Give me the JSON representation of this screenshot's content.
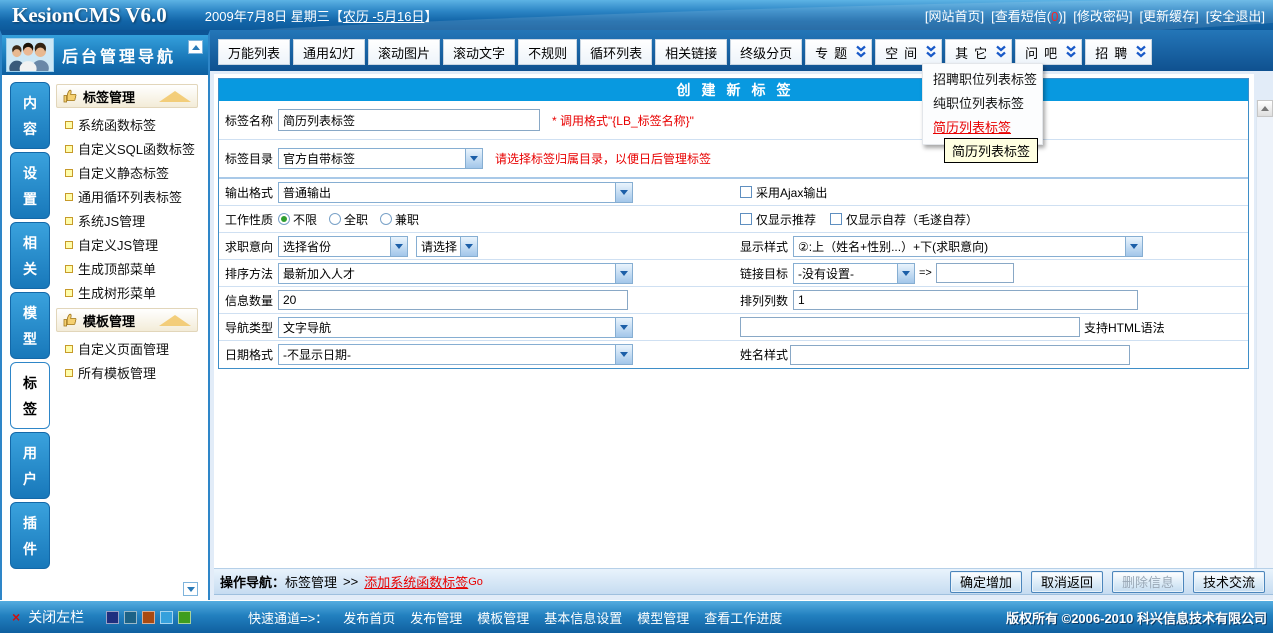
{
  "app": {
    "title": "KesionCMS V6.0"
  },
  "header": {
    "date": "2009年7月8日 星期三",
    "lunar_open": "【",
    "lunar": "农历 -5月16日",
    "lunar_close": "】",
    "link_home": "[网站首页]",
    "sms_pre": "[查看短信(",
    "sms_count": "0",
    "sms_post": ")]",
    "link_password": "[修改密码]",
    "link_cache": "[更新缓存]",
    "link_logout": "[安全退出]"
  },
  "sidebar": {
    "title": "后台管理导航",
    "tabs": [
      {
        "label": "内容"
      },
      {
        "label": "设置"
      },
      {
        "label": "相关"
      },
      {
        "label": "模型"
      },
      {
        "label": "标签"
      },
      {
        "label": "用户"
      },
      {
        "label": "插件"
      }
    ],
    "section1": {
      "title": "标签管理",
      "items": [
        "系统函数标签",
        "自定义SQL函数标签",
        "自定义静态标签",
        "通用循环列表标签",
        "系统JS管理",
        "自定义JS管理",
        "生成顶部菜单",
        "生成树形菜单"
      ]
    },
    "section2": {
      "title": "模板管理",
      "items": [
        "自定义页面管理",
        "所有模板管理"
      ]
    },
    "close_icon": "×",
    "close_label": "关闭左栏"
  },
  "nav": {
    "tabs": [
      "万能列表",
      "通用幻灯",
      "滚动图片",
      "滚动文字",
      "不规则",
      "循环列表",
      "相关链接",
      "终级分页"
    ],
    "dd_tabs": [
      "专题",
      "空间",
      "其它",
      "问吧",
      "招聘"
    ]
  },
  "menu": {
    "items": [
      "招聘职位列表标签",
      "纯职位列表标签",
      "简历列表标签"
    ],
    "tooltip": "简历列表标签"
  },
  "form": {
    "title": "创建新标签",
    "tag_name_label": "标签名称",
    "tag_name_value": "简历列表标签",
    "tag_name_hint": "* 调用格式\"{LB_标签名称}\"",
    "tag_dir_label": "标签目录",
    "tag_dir_value": "官方自带标签",
    "tag_dir_hint": "请选择标签归属目录，以便日后管理标签",
    "output_label": "输出格式",
    "output_value": "普通输出",
    "ajax_label": "采用Ajax输出",
    "work_label": "工作性质",
    "work_opt1": "不限",
    "work_opt2": "全职",
    "work_opt3": "兼职",
    "rec_label": "仅显示推荐",
    "self_label": "仅显示自荐（毛遂自荐）",
    "intent_label": "求职意向",
    "province_value": "选择省份",
    "city_value": "请选择",
    "style_label": "显示样式",
    "style_value": "②:上（姓名+性别...）+下(求职意向)",
    "sort_label": "排序方法",
    "sort_value": "最新加入人才",
    "target_label": "链接目标",
    "target_value": "-没有设置-",
    "target_arrow": "=>",
    "count_label": "信息数量",
    "count_value": "20",
    "cols_label": "排列列数",
    "cols_value": "1",
    "navtype_label": "导航类型",
    "navtype_value": "文字导航",
    "html_hint": "支持HTML语法",
    "date_label": "日期格式",
    "date_value": "-不显示日期-",
    "name_label": "姓名样式"
  },
  "action": {
    "nav_label": "操作导航：",
    "nav_path": "标签管理",
    "nav_sep": ">>",
    "nav_link": "添加系统函数标签",
    "nav_go": "Go",
    "btn_confirm": "确定增加",
    "btn_cancel": "取消返回",
    "btn_delete": "删除信息",
    "btn_tech": "技术交流"
  },
  "footer": {
    "quick": "快速通道=>：",
    "links": [
      "发布首页",
      "发布管理",
      "模板管理",
      "基本信息设置",
      "模型管理",
      "查看工作进度"
    ],
    "palette": [
      "#1f2f7f",
      "#1d6286",
      "#a84a12",
      "#35a0dc",
      "#3f9d1e"
    ],
    "copyright": "版权所有 ©2006-2010 科兴信息技术有限公司"
  },
  "colors": {
    "topbar_blue": "#1265a8",
    "panel_title_blue": "#0899e0",
    "highlight_red": "#e80000",
    "sidebar_tab_blue": "#1e8cca"
  }
}
